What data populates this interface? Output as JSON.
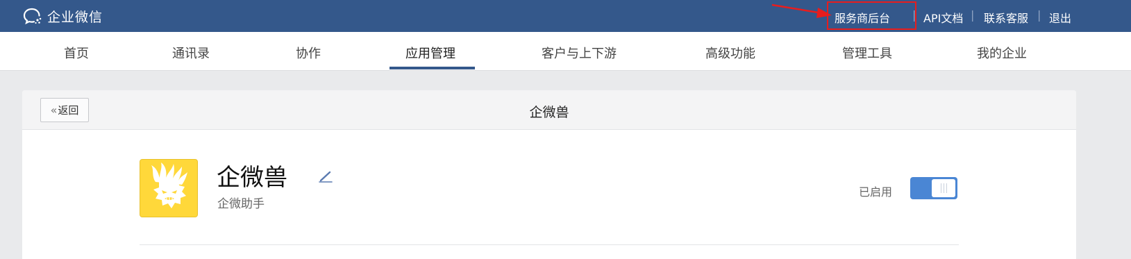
{
  "header": {
    "logo_text": "企业微信",
    "logo_icon": "wecom-chat-bubble-icon",
    "links": [
      {
        "label": "服务商后台"
      },
      {
        "label": "API文档"
      },
      {
        "label": "联系客服"
      },
      {
        "label": "退出"
      }
    ],
    "separator": "|",
    "annotation_color": "#e81d1d"
  },
  "nav": {
    "items": [
      {
        "label": "首页"
      },
      {
        "label": "通讯录"
      },
      {
        "label": "协作"
      },
      {
        "label": "应用管理"
      },
      {
        "label": "客户与上下游"
      },
      {
        "label": "高级功能"
      },
      {
        "label": "管理工具"
      },
      {
        "label": "我的企业"
      }
    ],
    "active": "应用管理"
  },
  "page": {
    "back_label": "返回",
    "title": "企微兽"
  },
  "app": {
    "name": "企微兽",
    "subtitle": "企微助手",
    "status_label": "已启用",
    "enabled": true,
    "icon": "beast-face-logo-icon",
    "icon_color": "#ffd83a"
  },
  "colors": {
    "brand": "#34588b",
    "toggle": "#4a86d4"
  }
}
